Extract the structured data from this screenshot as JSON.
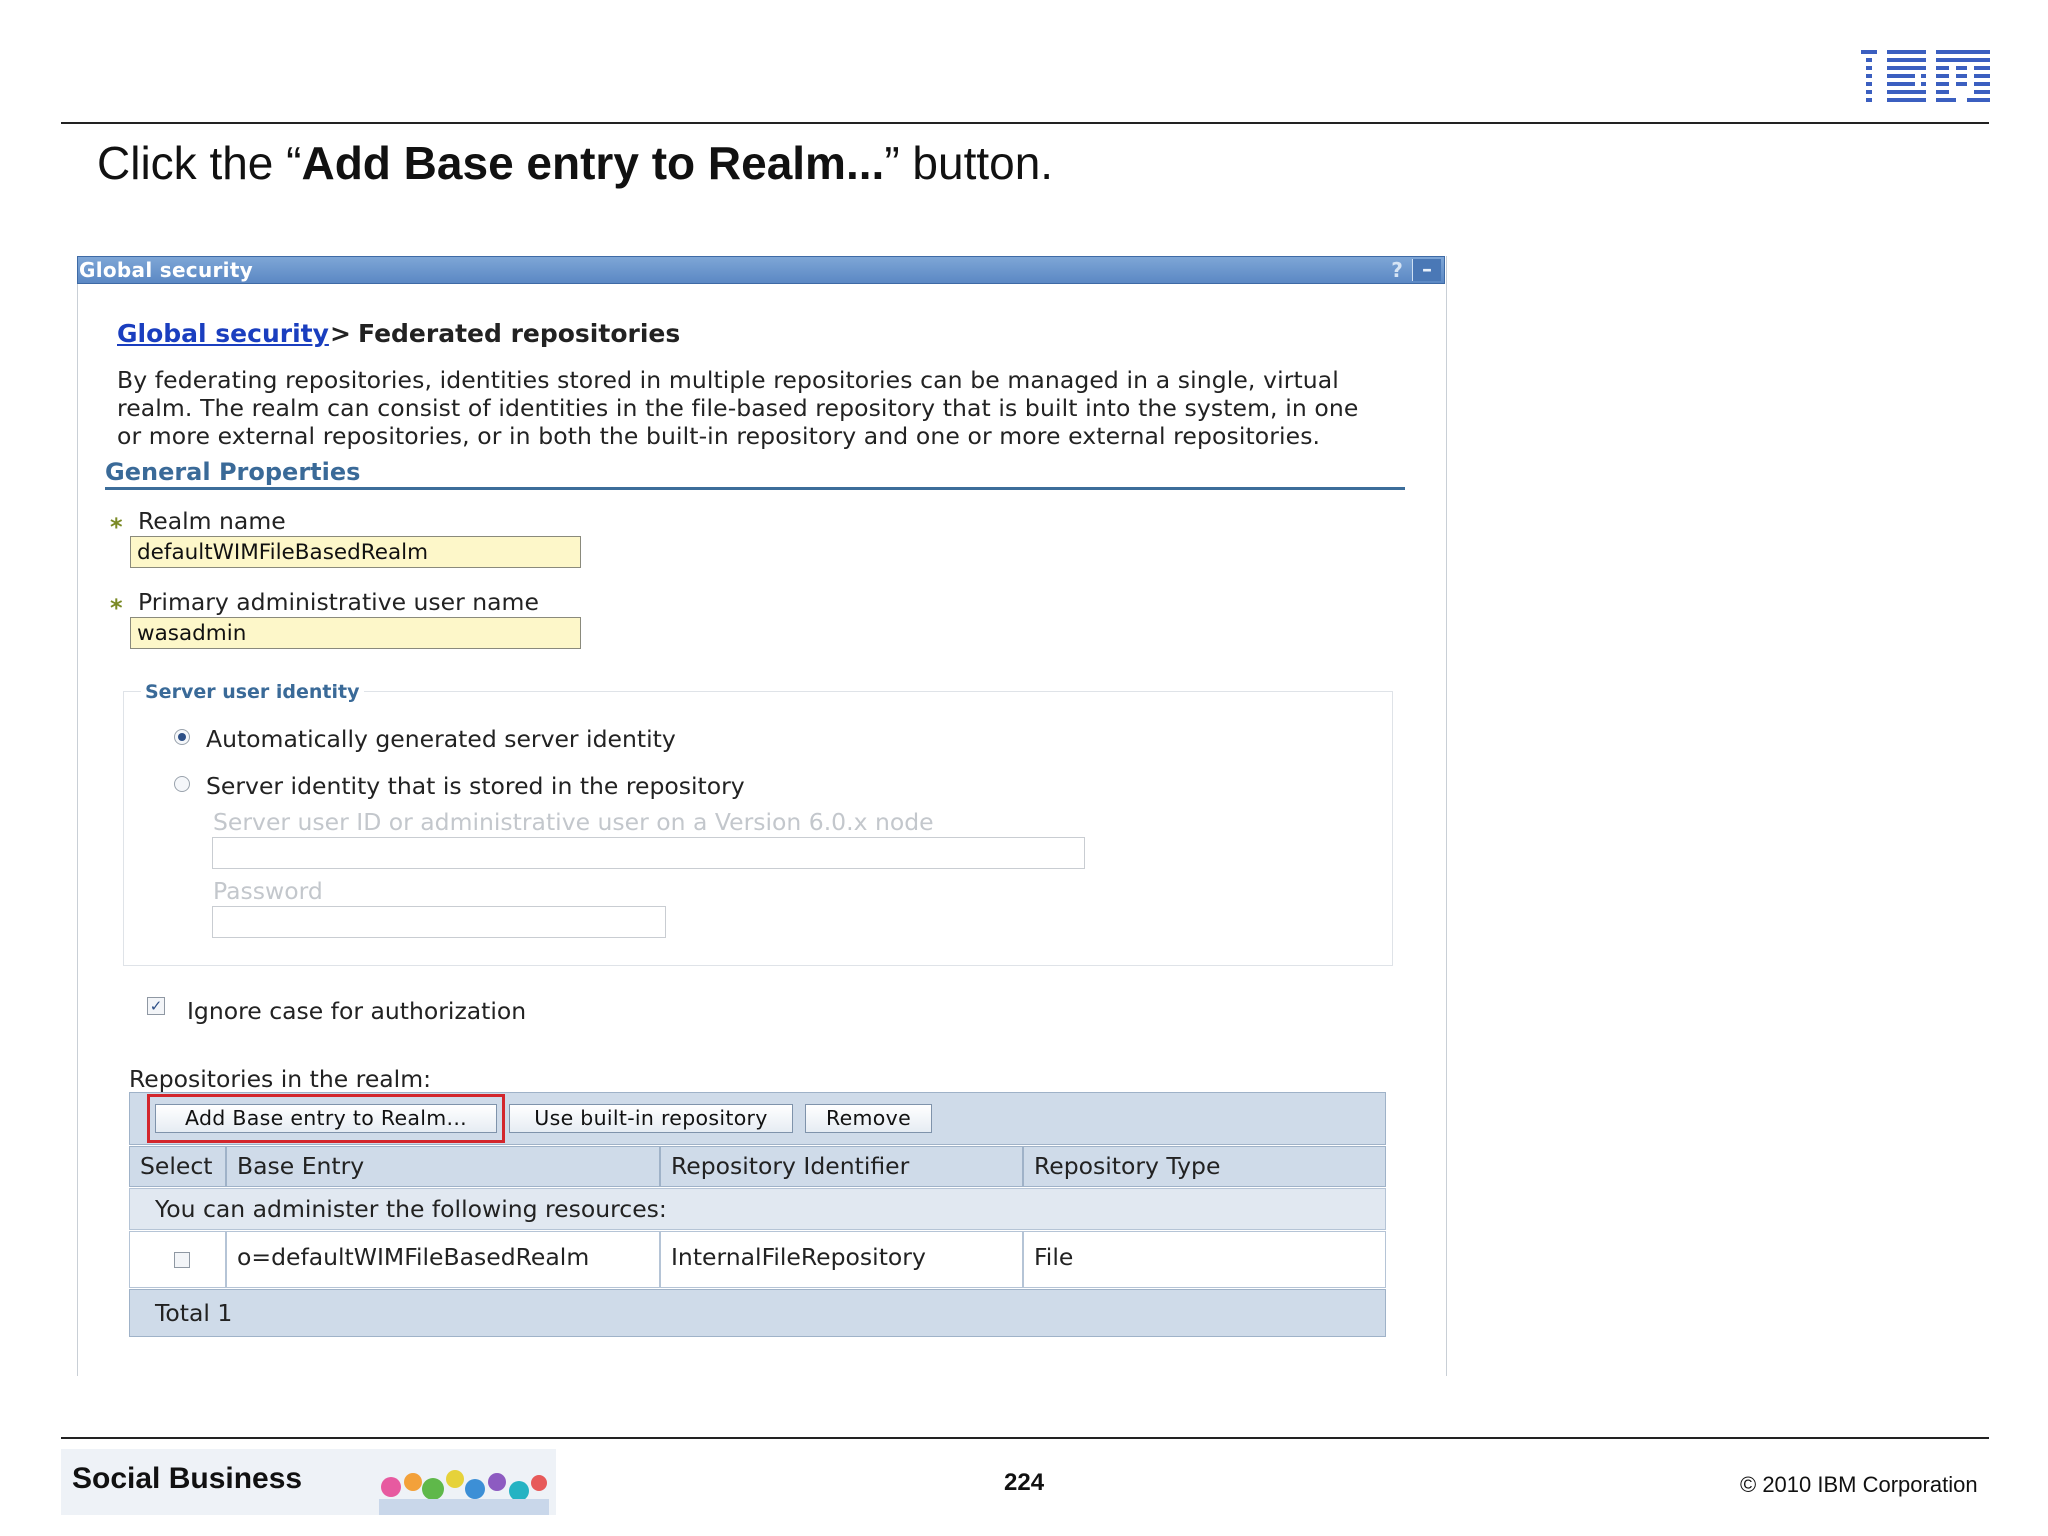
{
  "slide": {
    "logo_text": "IBM",
    "title_prefix": "Click the “",
    "title_bold": "Add Base entry to Realm...",
    "title_suffix": "” button."
  },
  "panel": {
    "title": "Global security",
    "help_icon": "?",
    "minimize_icon": "–",
    "breadcrumb": {
      "link": "Global security",
      "separator": ">",
      "current": "Federated repositories"
    },
    "description_lines": [
      "By federating repositories, identities stored in multiple repositories can be managed in a single, virtual",
      "realm. The realm can consist of identities in the file-based repository that is built into the system, in one",
      "or more external repositories, or in both the built-in repository and one or more external repositories."
    ],
    "general_properties": "General Properties",
    "required_marker": "*",
    "realm_name": {
      "label": "Realm name",
      "value": "defaultWIMFileBasedRealm"
    },
    "primary_admin": {
      "label": "Primary administrative user name",
      "value": "wasadmin"
    },
    "server_identity": {
      "legend": "Server user identity",
      "auto_label": "Automatically generated server identity",
      "auto_selected": true,
      "stored_label": "Server identity that is stored in the repository",
      "stored_selected": false,
      "server_user_label": "Server user ID or administrative user on a Version 6.0.x node",
      "server_user_value": "",
      "password_label": "Password",
      "password_value": ""
    },
    "ignore_case": {
      "label": "Ignore case for authorization",
      "checked": true,
      "mark": "✓"
    },
    "repositories": {
      "label": "Repositories in the realm:",
      "buttons": {
        "add": "Add Base entry to Realm...",
        "use_builtin": "Use built-in repository",
        "remove": "Remove"
      },
      "columns": [
        "Select",
        "Base Entry",
        "Repository Identifier",
        "Repository Type"
      ],
      "admin_note": "You can administer the following resources:",
      "rows": [
        {
          "base_entry": "o=defaultWIMFileBasedRealm",
          "identifier": "InternalFileRepository",
          "type": "File",
          "selected": false
        }
      ],
      "total": "Total 1"
    }
  },
  "footer": {
    "brand": "Social Business",
    "page_number": "224",
    "copyright": "© 2010 IBM Corporation"
  },
  "colors": {
    "highlight": "#d3262c",
    "link": "#1a3ebf",
    "section_heading": "#3a6a98",
    "field_background": "#fdf7c9",
    "table_header": "#cfdbe9"
  }
}
